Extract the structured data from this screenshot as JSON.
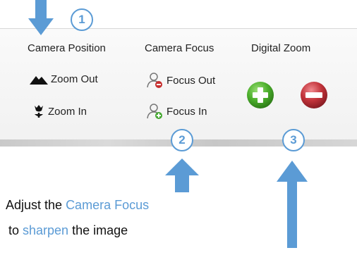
{
  "ribbon": {
    "groups": [
      {
        "label": "Camera Position"
      },
      {
        "label": "Camera Focus"
      },
      {
        "label": "Digital Zoom"
      }
    ],
    "camera_position": {
      "zoom_out": "Zoom Out",
      "zoom_in": "Zoom In"
    },
    "camera_focus": {
      "focus_out": "Focus Out",
      "focus_in": "Focus In"
    },
    "digital_zoom": {
      "zoom_in_icon": "plus-icon",
      "zoom_out_icon": "minus-icon"
    }
  },
  "callouts": {
    "one": "1",
    "two": "2",
    "three": "3"
  },
  "caption": {
    "line1_pre": "Adjust the ",
    "line1_hl": "Camera Focus",
    "line2_pre": "to ",
    "line2_hl": "sharpen",
    "line2_post": " the image"
  },
  "colors": {
    "accent": "#5b9bd5",
    "plus": "#4caf2c",
    "minus": "#c2333a"
  }
}
